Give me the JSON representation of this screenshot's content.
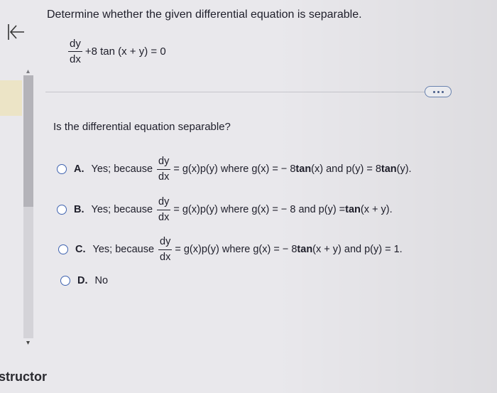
{
  "question": {
    "title": "Determine whether the given differential equation is separable.",
    "equation": {
      "numerator": "dy",
      "denominator": "dx",
      "rest": "+8 tan (x + y) = 0"
    },
    "prompt": "Is the differential equation separable?"
  },
  "options": [
    {
      "letter": "A.",
      "pre": "Yes; because",
      "num": "dy",
      "den": "dx",
      "post_a": "= g(x)p(y) where g(x) = − 8 ",
      "bold_a": "tan",
      "post_b": " (x) and p(y) = 8 ",
      "bold_b": "tan",
      "post_c": " (y)."
    },
    {
      "letter": "B.",
      "pre": "Yes; because",
      "num": "dy",
      "den": "dx",
      "post_a": "= g(x)p(y) where g(x) = − 8 and p(y) = ",
      "bold_a": "tan",
      "post_b": " (x + y)."
    },
    {
      "letter": "C.",
      "pre": "Yes; because",
      "num": "dy",
      "den": "dx",
      "post_a": "= g(x)p(y) where g(x) = − 8 ",
      "bold_a": "tan",
      "post_b": " (x + y) and p(y) = 1."
    },
    {
      "letter": "D.",
      "label": "No"
    }
  ],
  "sidebar": {
    "instructor_label": "structor"
  },
  "icons": {
    "back": "back-to-start-icon",
    "more": "more-options-icon",
    "scroll_up": "scroll-up-arrow-icon",
    "scroll_down": "scroll-down-arrow-icon"
  },
  "colors": {
    "radio_border": "#3f63b0",
    "more_button_border": "#6d87b5"
  }
}
